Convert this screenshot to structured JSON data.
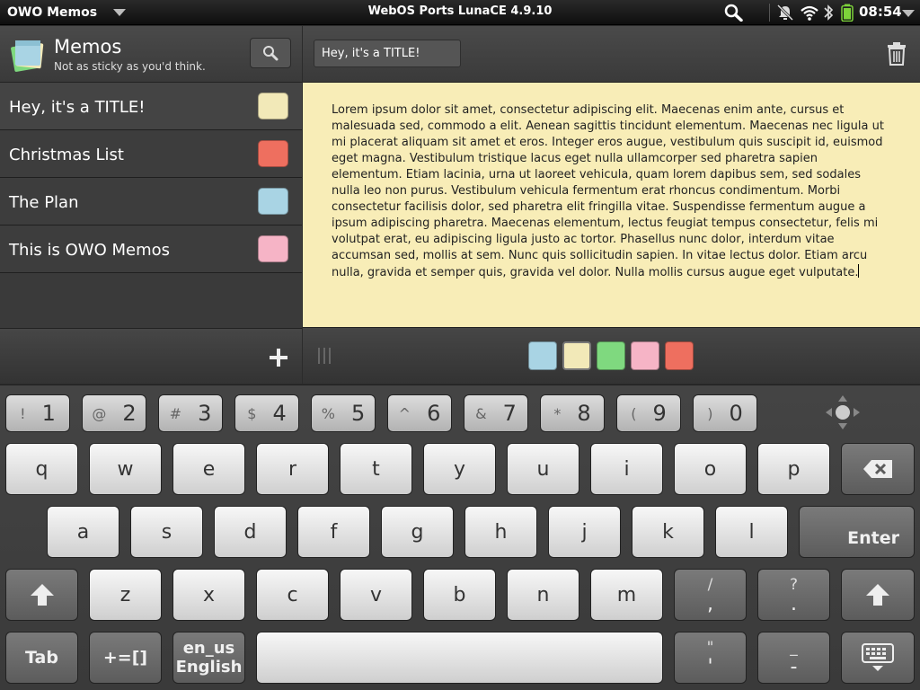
{
  "status_bar": {
    "app_menu": "OWO Memos",
    "title": "WebOS Ports LunaCE 4.9.10",
    "time": "08:54"
  },
  "sidebar": {
    "title": "Memos",
    "subtitle": "Not as sticky as you'd think.",
    "memos": [
      {
        "label": "Hey, it's a TITLE!",
        "color": "#f2e9b8"
      },
      {
        "label": "Christmas List",
        "color": "#ee6f5f"
      },
      {
        "label": "The Plan",
        "color": "#a9d4e4"
      },
      {
        "label": "This is OWO Memos",
        "color": "#f6b4c6"
      }
    ]
  },
  "editor": {
    "title_value": "Hey, it's a TITLE!",
    "body": "Lorem ipsum dolor sit amet, consectetur adipiscing elit. Maecenas enim ante, cursus et malesuada sed, commodo a elit. Aenean sagittis tincidunt elementum. Maecenas nec ligula ut mi placerat aliquam sit amet et eros. Integer eros augue, vestibulum quis suscipit id, euismod eget magna. Vestibulum tristique lacus eget nulla ullamcorper sed pharetra sapien elementum. Etiam lacinia, urna ut laoreet vehicula, quam lorem dapibus sem, sed sodales nulla leo non purus. Vestibulum vehicula fermentum erat rhoncus condimentum. Morbi consectetur facilisis dolor, sed pharetra elit fringilla vitae. Suspendisse fermentum augue a ipsum adipiscing pharetra. Maecenas elementum, lectus feugiat tempus consectetur, felis mi volutpat erat, eu adipiscing ligula justo ac tortor. Phasellus nunc dolor, interdum vitae accumsan sed, mollis at sem. Nunc quis sollicitudin sapien. In vitae lectus dolor. Etiam arcu nulla, gravida et semper quis, gravida vel dolor. Nulla mollis cursus augue eget vulputate.",
    "colors": [
      "#a9d4e4",
      "#f2e9b8",
      "#7fd97f",
      "#f6b4c6",
      "#ee6f5f"
    ],
    "selected_color_index": 1
  },
  "keyboard": {
    "number_row": [
      {
        "main": "1",
        "sub": "!"
      },
      {
        "main": "2",
        "sub": "@"
      },
      {
        "main": "3",
        "sub": "#"
      },
      {
        "main": "4",
        "sub": "$"
      },
      {
        "main": "5",
        "sub": "%"
      },
      {
        "main": "6",
        "sub": "^"
      },
      {
        "main": "7",
        "sub": "&"
      },
      {
        "main": "8",
        "sub": "*"
      },
      {
        "main": "9",
        "sub": "("
      },
      {
        "main": "0",
        "sub": ")"
      }
    ],
    "row1": [
      "q",
      "w",
      "e",
      "r",
      "t",
      "y",
      "u",
      "i",
      "o",
      "p"
    ],
    "row2": [
      "a",
      "s",
      "d",
      "f",
      "g",
      "h",
      "j",
      "k",
      "l"
    ],
    "row3": [
      "z",
      "x",
      "c",
      "v",
      "b",
      "n",
      "m"
    ],
    "enter": "Enter",
    "tab": "Tab",
    "symbols": "+=[]",
    "lang_top": "en_us",
    "lang_bottom": "English",
    "comma_top": "/",
    "comma_main": ",",
    "period_top": "?",
    "period_main": ".",
    "quote_top": "\"",
    "quote_main": "'",
    "dash_top": "_",
    "dash_main": "-"
  }
}
